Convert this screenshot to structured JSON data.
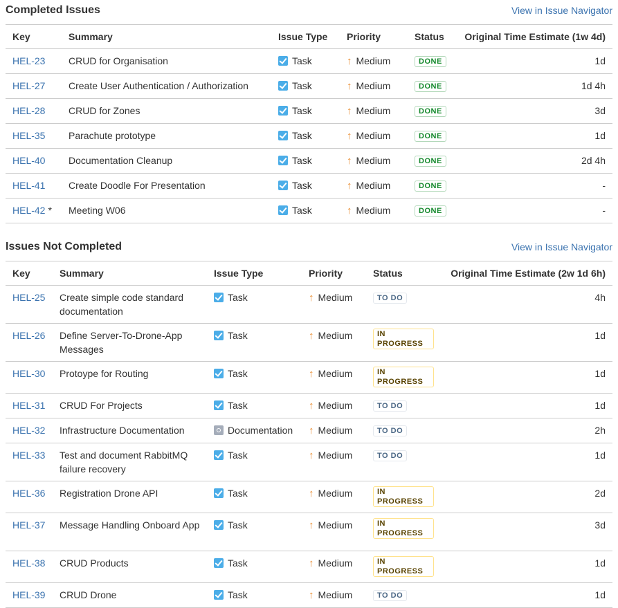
{
  "completed": {
    "title": "Completed Issues",
    "link": "View in Issue Navigator",
    "headers": {
      "key": "Key",
      "summary": "Summary",
      "type": "Issue Type",
      "priority": "Priority",
      "status": "Status",
      "estimate": "Original Time Estimate (1w 4d)"
    },
    "rows": [
      {
        "key": "HEL-23",
        "star": "",
        "summary": "CRUD for Organisation",
        "type": "Task",
        "type_icon": "task",
        "priority": "Medium",
        "status": "DONE",
        "status_kind": "done",
        "estimate": "1d"
      },
      {
        "key": "HEL-27",
        "star": "",
        "summary": "Create User Authentication / Authorization",
        "type": "Task",
        "type_icon": "task",
        "priority": "Medium",
        "status": "DONE",
        "status_kind": "done",
        "estimate": "1d 4h"
      },
      {
        "key": "HEL-28",
        "star": "",
        "summary": "CRUD for Zones",
        "type": "Task",
        "type_icon": "task",
        "priority": "Medium",
        "status": "DONE",
        "status_kind": "done",
        "estimate": "3d"
      },
      {
        "key": "HEL-35",
        "star": "",
        "summary": "Parachute prototype",
        "type": "Task",
        "type_icon": "task",
        "priority": "Medium",
        "status": "DONE",
        "status_kind": "done",
        "estimate": "1d"
      },
      {
        "key": "HEL-40",
        "star": "",
        "summary": "Documentation Cleanup",
        "type": "Task",
        "type_icon": "task",
        "priority": "Medium",
        "status": "DONE",
        "status_kind": "done",
        "estimate": "2d 4h"
      },
      {
        "key": "HEL-41",
        "star": "",
        "summary": "Create Doodle For Presentation",
        "type": "Task",
        "type_icon": "task",
        "priority": "Medium",
        "status": "DONE",
        "status_kind": "done",
        "estimate": "-"
      },
      {
        "key": "HEL-42",
        "star": "*",
        "summary": "Meeting W06",
        "type": "Task",
        "type_icon": "task",
        "priority": "Medium",
        "status": "DONE",
        "status_kind": "done",
        "estimate": "-"
      }
    ]
  },
  "not_completed": {
    "title": "Issues Not Completed",
    "link": "View in Issue Navigator",
    "headers": {
      "key": "Key",
      "summary": "Summary",
      "type": "Issue Type",
      "priority": "Priority",
      "status": "Status",
      "estimate": "Original Time Estimate (2w 1d 6h)"
    },
    "rows": [
      {
        "key": "HEL-25",
        "summary": "Create simple code standard documentation",
        "type": "Task",
        "type_icon": "task",
        "priority": "Medium",
        "status": "TO DO",
        "status_kind": "todo",
        "estimate": "4h",
        "tall": true
      },
      {
        "key": "HEL-26",
        "summary": "Define Server-To-Drone-App Messages",
        "type": "Task",
        "type_icon": "task",
        "priority": "Medium",
        "status": "IN PROGRESS",
        "status_kind": "inprog",
        "estimate": "1d",
        "tall": true
      },
      {
        "key": "HEL-30",
        "summary": "Protoype for Routing",
        "type": "Task",
        "type_icon": "task",
        "priority": "Medium",
        "status": "IN PROGRESS",
        "status_kind": "inprog",
        "estimate": "1d"
      },
      {
        "key": "HEL-31",
        "summary": "CRUD For Projects",
        "type": "Task",
        "type_icon": "task",
        "priority": "Medium",
        "status": "TO DO",
        "status_kind": "todo",
        "estimate": "1d"
      },
      {
        "key": "HEL-32",
        "summary": "Infrastructure Documentation",
        "type": "Documentation",
        "type_icon": "doc",
        "priority": "Medium",
        "status": "TO DO",
        "status_kind": "todo",
        "estimate": "2h"
      },
      {
        "key": "HEL-33",
        "summary": "Test and document RabbitMQ failure recovery",
        "type": "Task",
        "type_icon": "task",
        "priority": "Medium",
        "status": "TO DO",
        "status_kind": "todo",
        "estimate": "1d",
        "tall": true
      },
      {
        "key": "HEL-36",
        "summary": "Registration Drone API",
        "type": "Task",
        "type_icon": "task",
        "priority": "Medium",
        "status": "IN PROGRESS",
        "status_kind": "inprog",
        "estimate": "2d"
      },
      {
        "key": "HEL-37",
        "summary": "Message Handling Onboard App",
        "type": "Task",
        "type_icon": "task",
        "priority": "Medium",
        "status": "IN PROGRESS",
        "status_kind": "inprog",
        "estimate": "3d",
        "tall": true
      },
      {
        "key": "HEL-38",
        "summary": "CRUD Products",
        "type": "Task",
        "type_icon": "task",
        "priority": "Medium",
        "status": "IN PROGRESS",
        "status_kind": "inprog",
        "estimate": "1d"
      },
      {
        "key": "HEL-39",
        "summary": "CRUD Drone",
        "type": "Task",
        "type_icon": "task",
        "priority": "Medium",
        "status": "TO DO",
        "status_kind": "todo",
        "estimate": "1d"
      }
    ]
  }
}
